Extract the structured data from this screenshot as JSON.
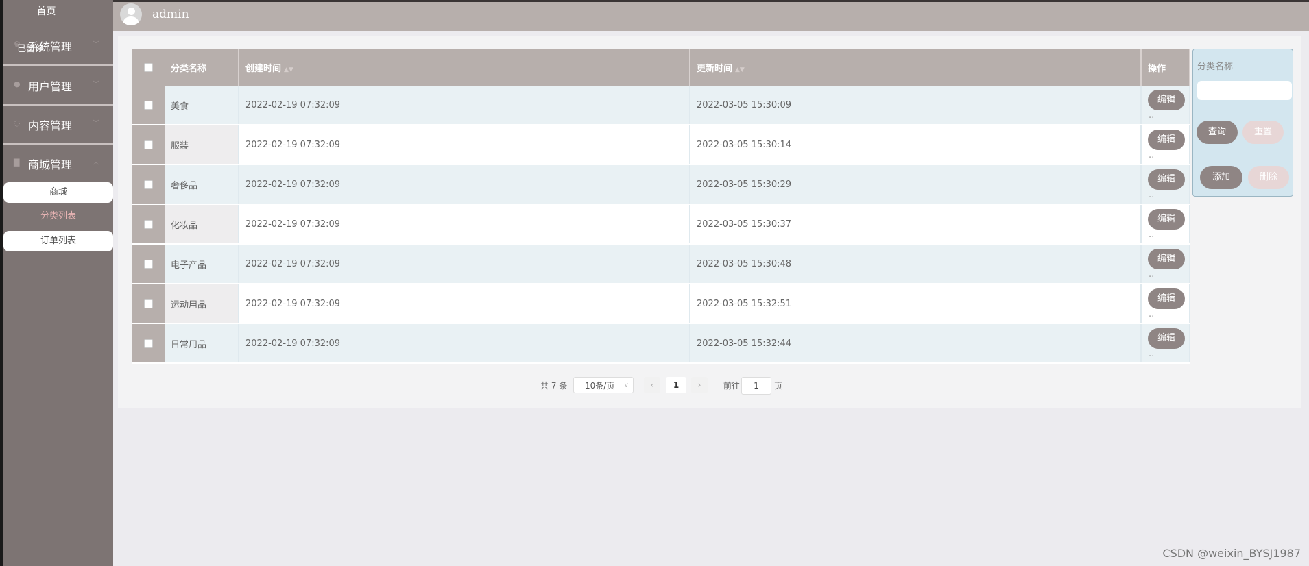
{
  "sidebar": {
    "home": "首页",
    "ghost_tag": "已暂停",
    "menus": [
      {
        "label": "系统管理",
        "icon": "gear-icon"
      },
      {
        "label": "用户管理",
        "icon": "user-icon"
      },
      {
        "label": "内容管理",
        "icon": "chat-icon"
      },
      {
        "label": "商城管理",
        "icon": "shop-icon"
      }
    ],
    "submenu": [
      {
        "label": "商城"
      },
      {
        "label": "分类列表"
      },
      {
        "label": "订单列表"
      }
    ]
  },
  "header": {
    "username": "admin"
  },
  "table": {
    "columns": [
      "分类名称",
      "创建时间",
      "更新时间",
      "操作"
    ],
    "edit_label": "编辑",
    "rows": [
      {
        "name": "美食",
        "created": "2022-02-19 07:32:09",
        "updated": "2022-03-05 15:30:09"
      },
      {
        "name": "服装",
        "created": "2022-02-19 07:32:09",
        "updated": "2022-03-05 15:30:14"
      },
      {
        "name": "奢侈品",
        "created": "2022-02-19 07:32:09",
        "updated": "2022-03-05 15:30:29"
      },
      {
        "name": "化妆品",
        "created": "2022-02-19 07:32:09",
        "updated": "2022-03-05 15:30:37"
      },
      {
        "name": "电子产品",
        "created": "2022-02-19 07:32:09",
        "updated": "2022-03-05 15:30:48"
      },
      {
        "name": "运动用品",
        "created": "2022-02-19 07:32:09",
        "updated": "2022-03-05 15:32:51"
      },
      {
        "name": "日常用品",
        "created": "2022-02-19 07:32:09",
        "updated": "2022-03-05 15:32:44"
      }
    ]
  },
  "search": {
    "label": "分类名称",
    "query_label": "查询",
    "reset_label": "重置",
    "add_label": "添加",
    "delete_label": "删除"
  },
  "pagination": {
    "total": "共 7 条",
    "page_size": "10条/页",
    "current": "1",
    "goto_label": "前往",
    "goto_value": "1",
    "page_unit": "页"
  },
  "watermark": "CSDN @weixin_BYSJ1987"
}
